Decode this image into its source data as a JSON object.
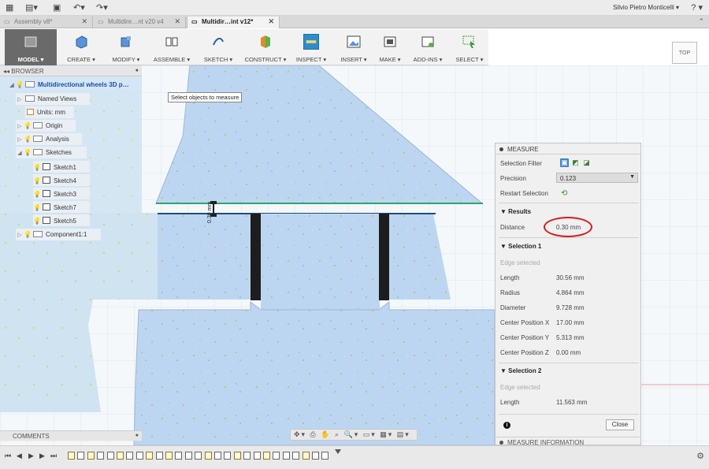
{
  "topbar": {
    "user": "Silvio Pietro Monticelli ▾",
    "help": "? ▾",
    "icons": [
      "grid-icon",
      "file-icon",
      "save-icon",
      "undo-icon",
      "redo-icon"
    ]
  },
  "tabs": [
    {
      "label": "Assembly v8*",
      "active": false
    },
    {
      "label": "Multidire…nt v20 v4",
      "active": false
    },
    {
      "label": "Multidir…int v12*",
      "active": true
    }
  ],
  "toolbar": {
    "items": [
      {
        "name": "model",
        "label": "MODEL ▾"
      },
      {
        "name": "create",
        "label": "CREATE ▾"
      },
      {
        "name": "modify",
        "label": "MODIFY ▾"
      },
      {
        "name": "assemble",
        "label": "ASSEMBLE ▾"
      },
      {
        "name": "sketch",
        "label": "SKETCH ▾"
      },
      {
        "name": "construct",
        "label": "CONSTRUCT ▾"
      },
      {
        "name": "inspect",
        "label": "INSPECT ▾"
      },
      {
        "name": "insert",
        "label": "INSERT ▾"
      },
      {
        "name": "make",
        "label": "MAKE ▾"
      },
      {
        "name": "addins",
        "label": "ADD-INS ▾"
      },
      {
        "name": "select",
        "label": "SELECT ▾"
      }
    ]
  },
  "viewcube": {
    "label": "TOP"
  },
  "tooltip": "Select objects to measure",
  "dimension_label": "0.30 mm",
  "browser": {
    "title": "BROWSER",
    "items": [
      {
        "label": "Multidirectional wheels 3D p…"
      },
      {
        "label": "Named Views"
      },
      {
        "label": "Units: mm"
      },
      {
        "label": "Origin"
      },
      {
        "label": "Analysis"
      },
      {
        "label": "Sketches"
      },
      {
        "label": "Sketch1"
      },
      {
        "label": "Sketch4"
      },
      {
        "label": "Sketch3"
      },
      {
        "label": "Sketch7"
      },
      {
        "label": "Sketch5"
      },
      {
        "label": "Component1:1"
      }
    ]
  },
  "measure": {
    "title": "MEASURE",
    "selection_filter_label": "Selection Filter",
    "precision_label": "Precision",
    "precision_value": "0.123",
    "restart_label": "Restart Selection",
    "results_title": "Results",
    "distance_label": "Distance",
    "distance_value": "0.30 mm",
    "selection1_title": "Selection 1",
    "selection1_type": "Edge selected",
    "selection1": [
      {
        "label": "Length",
        "value": "30.56 mm"
      },
      {
        "label": "Radius",
        "value": "4.864 mm"
      },
      {
        "label": "Diameter",
        "value": "9.728 mm"
      },
      {
        "label": "Center Position X",
        "value": "17.00 mm"
      },
      {
        "label": "Center Position Y",
        "value": "5.313 mm"
      },
      {
        "label": "Center Position Z",
        "value": "0.00 mm"
      }
    ],
    "selection2_title": "Selection 2",
    "selection2_type": "Edge selected",
    "selection2": [
      {
        "label": "Length",
        "value": "11.563 mm"
      }
    ],
    "close_label": "Close",
    "info_label": "MEASURE INFORMATION"
  },
  "comments": {
    "title": "COMMENTS"
  },
  "navbar": {
    "icons": "✥▾ ⎙ ✋ ⌕ 🔍▾ ▭▾ ▦▾ ▤▾"
  },
  "colors": {
    "accent": "#2f8ccc",
    "solid_fill": "#bcd6f2",
    "highlight": "#d61a1a"
  }
}
